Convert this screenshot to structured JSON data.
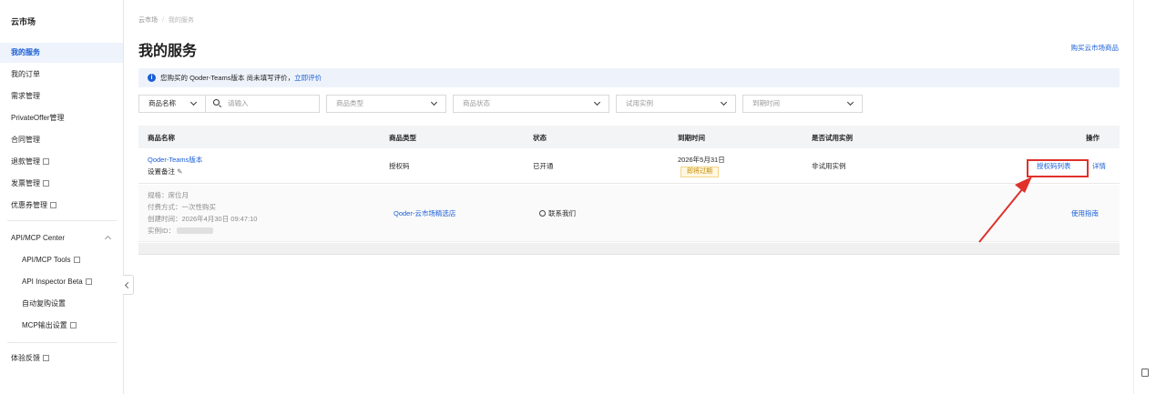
{
  "sidebar": {
    "title": "云市场",
    "items": [
      {
        "label": "我的服务"
      },
      {
        "label": "我的订单"
      },
      {
        "label": "需求管理"
      },
      {
        "label": "PrivateOffer管理"
      },
      {
        "label": "合同管理"
      },
      {
        "label": "退款管理"
      },
      {
        "label": "发票管理"
      },
      {
        "label": "优惠券管理"
      },
      {
        "label": "API/MCP Center"
      },
      {
        "label": "API/MCP Tools"
      },
      {
        "label": "API Inspector Beta"
      },
      {
        "label": "自动复购设置"
      },
      {
        "label": "MCP输出设置"
      },
      {
        "label": "体验反馈"
      }
    ]
  },
  "breadcrumb": {
    "root": "云市场",
    "sep": "/",
    "current": "我的服务"
  },
  "page": {
    "title": "我的服务",
    "buy_link": "购买云市场商品"
  },
  "notice": {
    "text": "您购买的 Qoder-Teams版本 尚未填写评价，",
    "link": "立即评价"
  },
  "filters": {
    "name_select": "商品名称",
    "search_placeholder": "请输入",
    "type_placeholder": "商品类型",
    "status_placeholder": "商品状态",
    "trial_placeholder": "试用实例",
    "expire_placeholder": "到期时间"
  },
  "table": {
    "headers": [
      "商品名称",
      "商品类型",
      "状态",
      "到期时间",
      "是否试用实例",
      "操作"
    ],
    "row": {
      "name": "Qoder-Teams版本",
      "remark": "设置备注",
      "type": "授权码",
      "status": "已开通",
      "expire_date": "2026年5月31日",
      "expire_tag": "即将过期",
      "trial": "非试用实例",
      "action_license": "授权码列表",
      "action_detail": "详情"
    },
    "detail": {
      "spec": "规格：席位月",
      "pay": "付费方式：一次性购买",
      "created": "创建时间：2026年4月30日 09:47:10",
      "instance_label": "实例ID：",
      "store": "Qoder-云市场精选店",
      "contact": "联系我们",
      "guide": "使用指南"
    }
  },
  "colors": {
    "accent": "#1a5fd6",
    "annotation": "#e0312b",
    "warning_tag": "#c48a00"
  }
}
